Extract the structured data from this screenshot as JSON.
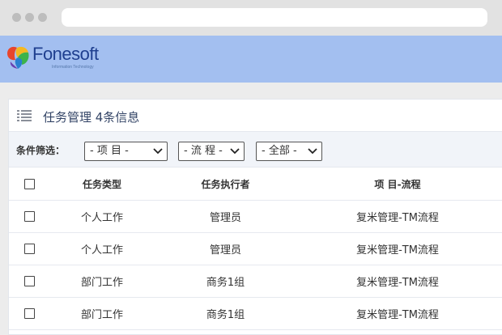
{
  "brand": {
    "name": "Fonesoft",
    "tagline": "Information Technology"
  },
  "panel": {
    "icon": "list-icon",
    "title": "任务管理 4条信息"
  },
  "filters": {
    "label": "条件筛选：",
    "project": "- 项 目 -",
    "process": "- 流 程 -",
    "status": "- 全部 -"
  },
  "table": {
    "columns": [
      "任务类型",
      "任务执行者",
      "项 目-流程"
    ],
    "rows": [
      {
        "type": "个人工作",
        "executor": "管理员",
        "project": "复米管理-TM流程"
      },
      {
        "type": "个人工作",
        "executor": "管理员",
        "project": "复米管理-TM流程"
      },
      {
        "type": "部门工作",
        "executor": "商务1组",
        "project": "复米管理-TM流程"
      },
      {
        "type": "部门工作",
        "executor": "商务1组",
        "project": "复米管理-TM流程"
      }
    ]
  },
  "colors": {
    "brand_bar": "#a3bff0",
    "logo_text": "#1f3f8f",
    "filter_bg": "#f1f4f9"
  }
}
